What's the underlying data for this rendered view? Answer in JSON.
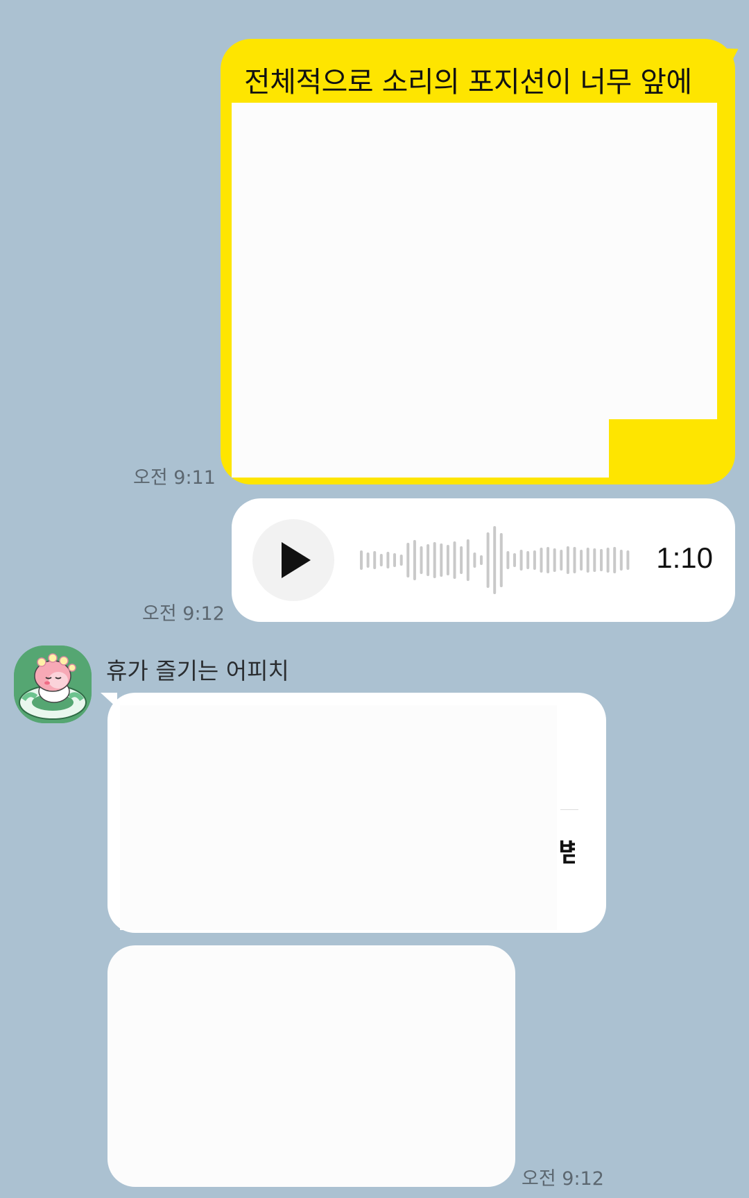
{
  "chat": {
    "outgoing_text": "전체적으로 소리의 포지션이 너무 앞에",
    "outgoing_time": "오전 9:11",
    "voice_duration": "1:10",
    "voice_time": "오전 9:12",
    "sender_name": "휴가 즐기는 어피치",
    "incoming_fragment": "볌",
    "incoming_time": "오전 9:12"
  },
  "icons": {
    "play": "play-icon",
    "waveform": "waveform-icon",
    "avatar": "apeach-avatar"
  },
  "colors": {
    "background": "#abc1d1",
    "outgoing_bubble": "#fee500",
    "incoming_bubble": "#ffffff",
    "avatar_bg": "#55a672"
  }
}
